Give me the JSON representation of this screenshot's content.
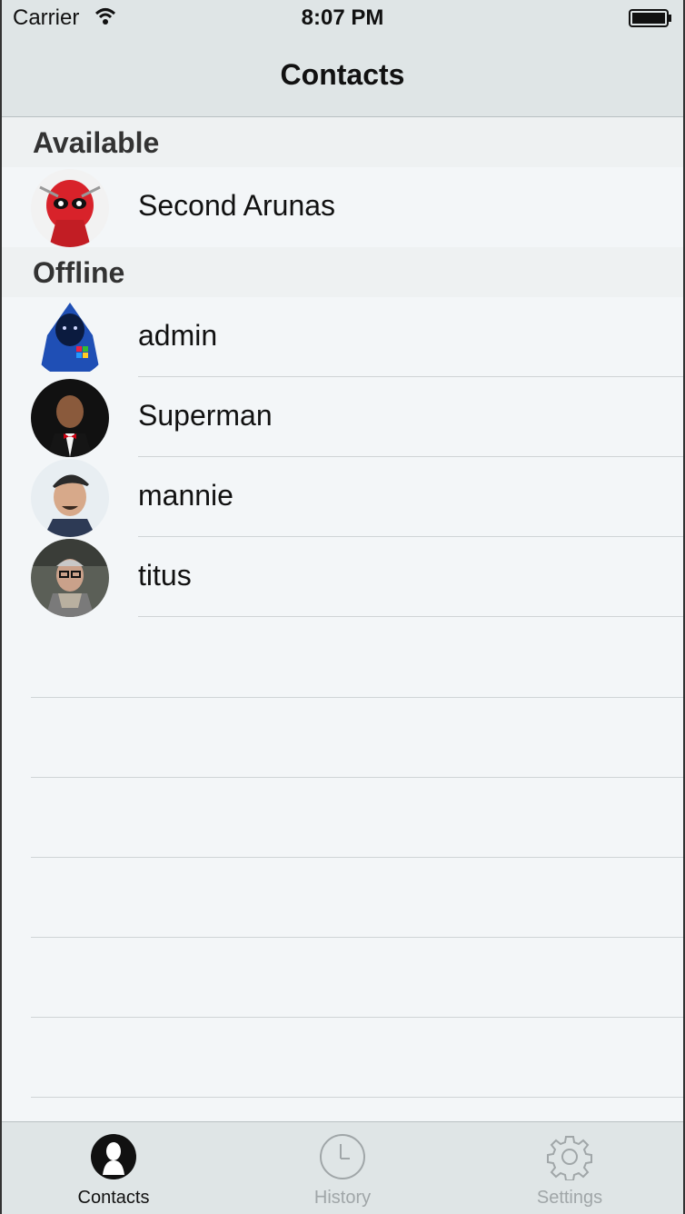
{
  "status": {
    "carrier": "Carrier",
    "time": "8:07 PM"
  },
  "nav": {
    "title": "Contacts"
  },
  "sections": [
    {
      "title": "Available",
      "contacts": [
        {
          "name": "Second Arunas",
          "avatar": "deadpool-avatar"
        }
      ]
    },
    {
      "title": "Offline",
      "contacts": [
        {
          "name": "admin",
          "avatar": "hooded-figure-avatar"
        },
        {
          "name": "Superman",
          "avatar": "man-bowtie-avatar"
        },
        {
          "name": "mannie",
          "avatar": "man-cap-avatar"
        },
        {
          "name": "titus",
          "avatar": "man-glasses-avatar"
        }
      ]
    }
  ],
  "tabs": [
    {
      "label": "Contacts",
      "icon": "person-icon",
      "active": true
    },
    {
      "label": "History",
      "icon": "clock-icon",
      "active": false
    },
    {
      "label": "Settings",
      "icon": "gear-icon",
      "active": false
    }
  ],
  "colors": {
    "bar": "#dfe5e6",
    "background": "#f3f6f8",
    "section": "#eef1f2",
    "inactive": "#a0a6a8"
  }
}
